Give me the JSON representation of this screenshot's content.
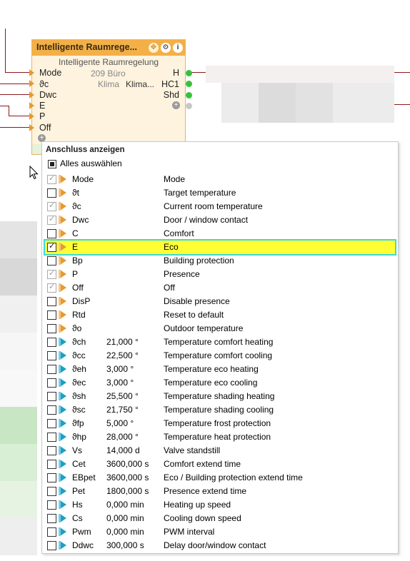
{
  "node": {
    "title": "Intelligente Raumrege...",
    "subtitle": "Intelligente Raumregelung",
    "icons": [
      "move-icon",
      "gear-icon",
      "info-icon"
    ],
    "inputs": [
      {
        "label": "Mode",
        "value": "209 Büro"
      },
      {
        "label": "ϑc",
        "value": "Klima",
        "value2": "Klima..."
      },
      {
        "label": "Dwc",
        "value": ""
      },
      {
        "label": "E",
        "value": ""
      },
      {
        "label": "P",
        "value": ""
      },
      {
        "label": "Off",
        "value": ""
      }
    ],
    "outputs": [
      "H",
      "HC1",
      "Shd"
    ]
  },
  "menu": {
    "title": "Anschluss anzeigen",
    "select_all": "Alles auswählen",
    "rows": [
      {
        "abbr": "Mode",
        "value": "",
        "desc": "Mode",
        "type": "input",
        "state": "checked-grey"
      },
      {
        "abbr": "ϑt",
        "value": "",
        "desc": "Target temperature",
        "type": "input",
        "state": "unchecked"
      },
      {
        "abbr": "ϑc",
        "value": "",
        "desc": "Current room temperature",
        "type": "input",
        "state": "checked-grey"
      },
      {
        "abbr": "Dwc",
        "value": "",
        "desc": "Door / window contact",
        "type": "input",
        "state": "checked-grey"
      },
      {
        "abbr": "C",
        "value": "",
        "desc": "Comfort",
        "type": "input",
        "state": "unchecked"
      },
      {
        "abbr": "E",
        "value": "",
        "desc": "Eco",
        "type": "input",
        "state": "checked",
        "highlight": true
      },
      {
        "abbr": "Bp",
        "value": "",
        "desc": "Building protection",
        "type": "input",
        "state": "unchecked"
      },
      {
        "abbr": "P",
        "value": "",
        "desc": "Presence",
        "type": "input",
        "state": "checked-grey"
      },
      {
        "abbr": "Off",
        "value": "",
        "desc": "Off",
        "type": "input",
        "state": "checked-grey"
      },
      {
        "abbr": "DisP",
        "value": "",
        "desc": "Disable presence",
        "type": "input",
        "state": "unchecked"
      },
      {
        "abbr": "Rtd",
        "value": "",
        "desc": "Reset to default",
        "type": "input",
        "state": "unchecked"
      },
      {
        "abbr": "ϑo",
        "value": "",
        "desc": "Outdoor temperature",
        "type": "input",
        "state": "unchecked"
      },
      {
        "abbr": "ϑch",
        "value": "21,000 °",
        "desc": "Temperature comfort heating",
        "type": "param",
        "state": "unchecked"
      },
      {
        "abbr": "ϑcc",
        "value": "22,500 °",
        "desc": "Temperature comfort cooling",
        "type": "param",
        "state": "unchecked"
      },
      {
        "abbr": "ϑeh",
        "value": "3,000 °",
        "desc": "Temperature eco heating",
        "type": "param",
        "state": "unchecked"
      },
      {
        "abbr": "ϑec",
        "value": "3,000 °",
        "desc": "Temperature eco cooling",
        "type": "param",
        "state": "unchecked"
      },
      {
        "abbr": "ϑsh",
        "value": "25,500 °",
        "desc": "Temperature shading heating",
        "type": "param",
        "state": "unchecked"
      },
      {
        "abbr": "ϑsc",
        "value": "21,750 °",
        "desc": "Temperature shading cooling",
        "type": "param",
        "state": "unchecked"
      },
      {
        "abbr": "ϑfp",
        "value": "5,000 °",
        "desc": "Temperature frost protection",
        "type": "param",
        "state": "unchecked"
      },
      {
        "abbr": "ϑhp",
        "value": "28,000 °",
        "desc": "Temperature heat protection",
        "type": "param",
        "state": "unchecked"
      },
      {
        "abbr": "Vs",
        "value": "14,000 d",
        "desc": "Valve standstill",
        "type": "param",
        "state": "unchecked"
      },
      {
        "abbr": "Cet",
        "value": "3600,000 s",
        "desc": "Comfort extend time",
        "type": "param",
        "state": "unchecked"
      },
      {
        "abbr": "EBpet",
        "value": "3600,000 s",
        "desc": "Eco / Building protection extend time",
        "type": "param",
        "state": "unchecked"
      },
      {
        "abbr": "Pet",
        "value": "1800,000 s",
        "desc": "Presence extend time",
        "type": "param",
        "state": "unchecked"
      },
      {
        "abbr": "Hs",
        "value": "0,000 min",
        "desc": "Heating up speed",
        "type": "param",
        "state": "unchecked"
      },
      {
        "abbr": "Cs",
        "value": "0,000 min",
        "desc": "Cooling down speed",
        "type": "param",
        "state": "unchecked"
      },
      {
        "abbr": "Pwm",
        "value": "0,000 min",
        "desc": "PWM interval",
        "type": "param",
        "state": "unchecked"
      },
      {
        "abbr": "Ddwc",
        "value": "300,000 s",
        "desc": "Delay door/window contact",
        "type": "param",
        "state": "unchecked"
      }
    ]
  },
  "colors": {
    "node_header": "#f3b047",
    "input_pin": "#e89a2c",
    "param_pin": "#1aa0c6",
    "output_pin": "#38c238",
    "highlight": "#ffff33",
    "highlight_border": "#3cd9d9",
    "wire": "#8b1a1a"
  }
}
